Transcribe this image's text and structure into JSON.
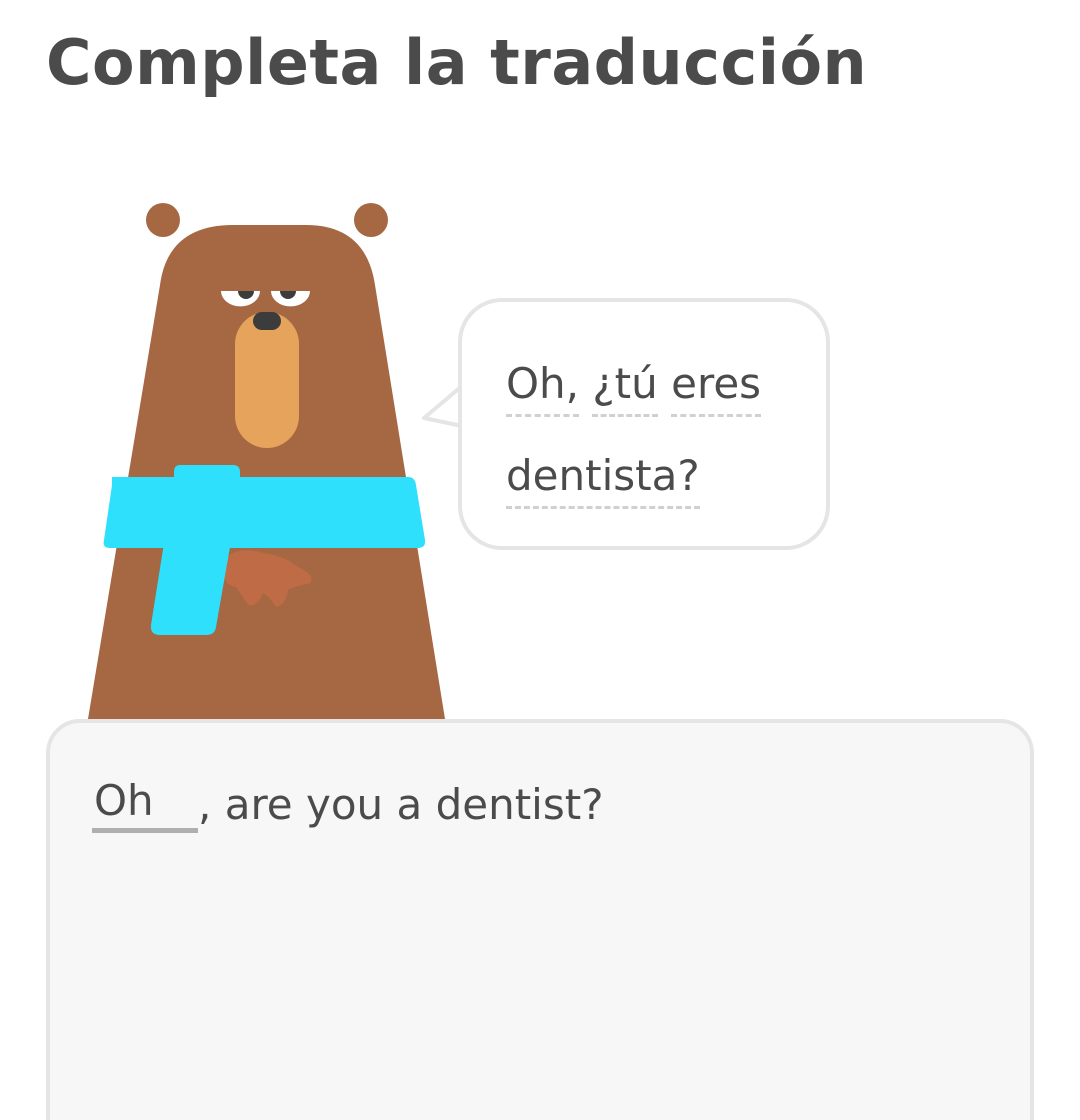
{
  "header": {
    "title": "Completa la traducción"
  },
  "character": {
    "name_icon": "bear-character",
    "colors": {
      "fur": "#a66743",
      "muzzle": "#e5a35b",
      "scarf": "#2fe0fd",
      "nose": "#3c3c3c"
    }
  },
  "speech_bubble": {
    "words": [
      "Oh,",
      "¿tú",
      "eres",
      "dentista?"
    ]
  },
  "answer": {
    "input_value": "Oh",
    "rest_text": ", are you a dentist?"
  },
  "colors": {
    "text": "#4b4b4b",
    "border": "#e5e5e5",
    "answer_bg": "#f7f7f7",
    "input_underline": "#afafaf"
  }
}
